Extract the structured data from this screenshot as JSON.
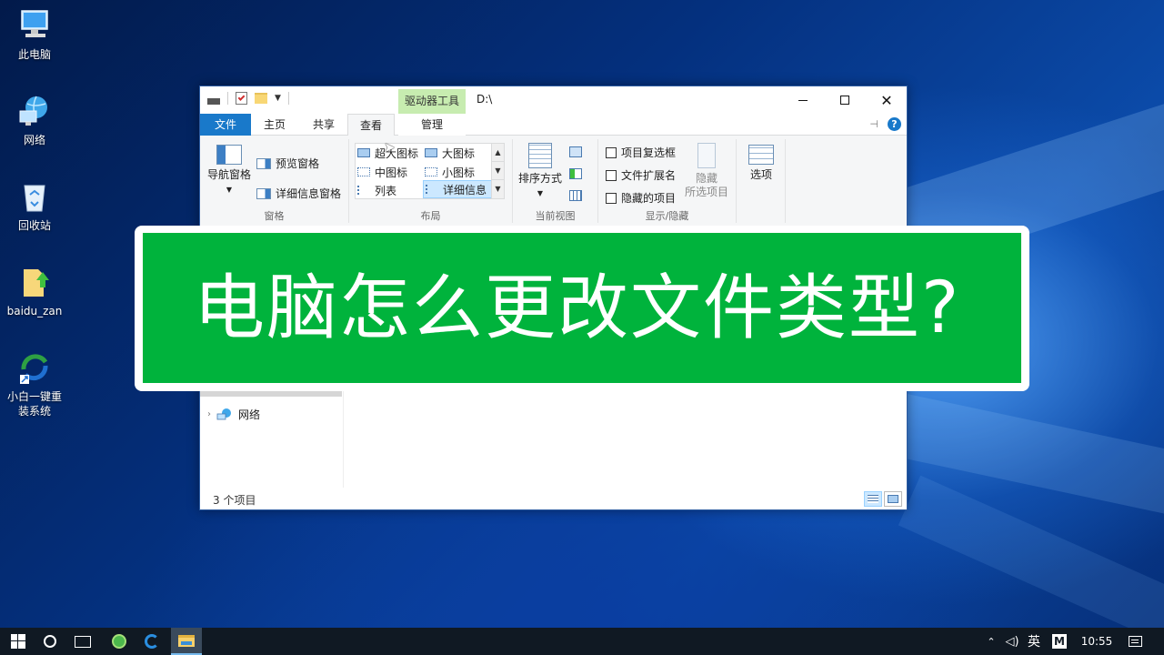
{
  "desktop": {
    "icons": [
      {
        "label": "此电脑",
        "icon": "computer-icon"
      },
      {
        "label": "网络",
        "icon": "network-globe-icon"
      },
      {
        "label": "回收站",
        "icon": "recycle-bin-icon"
      },
      {
        "label": "baidu_zan",
        "icon": "folder-arrow-icon"
      },
      {
        "label_line1": "小白一键重",
        "label_line2": "装系统",
        "icon": "reinstall-app-icon"
      }
    ]
  },
  "window": {
    "context_tab": "驱动器工具",
    "path": "D:\\",
    "tabs": {
      "file": "文件",
      "home": "主页",
      "share": "共享",
      "view": "查看",
      "manage": "管理"
    },
    "ribbon": {
      "pane_group": {
        "nav_pane": "导航窗格",
        "preview_pane": "预览窗格",
        "details_pane": "详细信息窗格",
        "title": "窗格"
      },
      "layout_group": {
        "items": {
          "extra_large": "超大图标",
          "large": "大图标",
          "medium": "中图标",
          "small": "小图标",
          "list": "列表",
          "details": "详细信息"
        },
        "selected": "详细信息",
        "title": "布局"
      },
      "current_view_group": {
        "sort_by": "排序方式",
        "title": "当前视图"
      },
      "show_hide_group": {
        "item_checkboxes": "项目复选框",
        "file_extensions": "文件扩展名",
        "hidden_items": "隐藏的项目",
        "hide_selected_line1": "隐藏",
        "hide_selected_line2": "所选项目",
        "title": "显示/隐藏"
      },
      "options": "选项"
    },
    "nav": {
      "network": "网络"
    },
    "status": "3 个项目"
  },
  "banner": {
    "title": "电脑怎么更改文件类型?"
  },
  "taskbar": {
    "ime": "英",
    "ime2": "M",
    "time": "10:55"
  },
  "colors": {
    "banner_green": "#00b33c",
    "file_tab_blue": "#1979ca",
    "context_tab_green": "#c7ecb0"
  }
}
